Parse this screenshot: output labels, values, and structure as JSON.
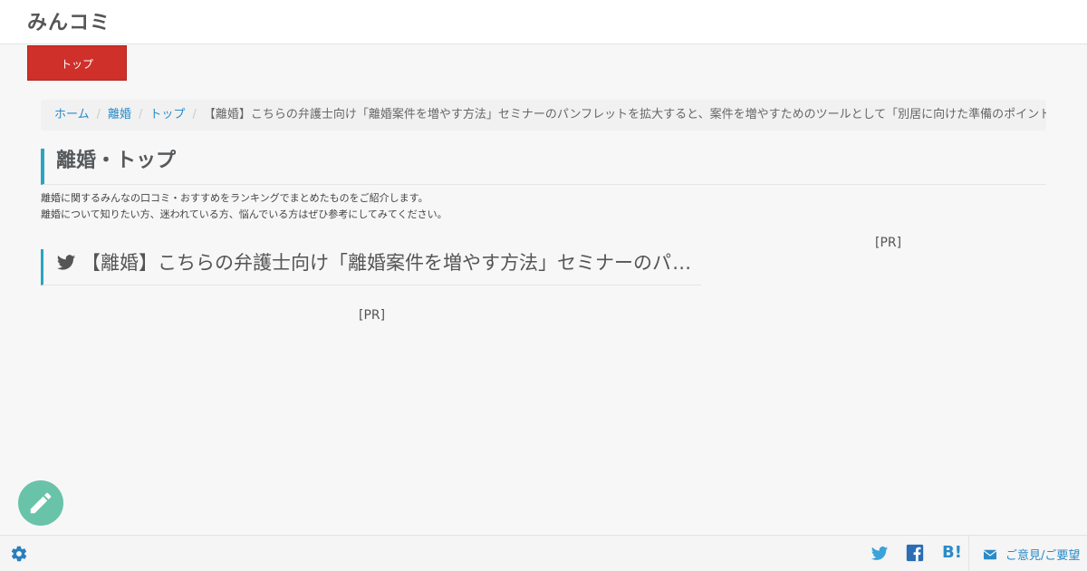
{
  "header": {
    "logo": "みんコミ"
  },
  "nav": {
    "active_tab": "トップ"
  },
  "breadcrumb": {
    "home": "ホーム",
    "category": "離婚",
    "section": "トップ",
    "current": "【離婚】こちらの弁護士向け「離婚案件を増やす方法」セミナーのパンフレットを拡大すると、案件を増やすためのツールとして「別居に向けた準備のポイント」"
  },
  "page": {
    "title": "離婚・トップ",
    "description_line1": "離婚に関するみんなの口コミ・おすすめをランキングでまとめたものをご紹介します。",
    "description_line2": "離婚について知りたい方、迷われている方、悩んでいる方はぜひ参考にしてみてください。"
  },
  "article": {
    "title": "【離婚】こちらの弁護士向け「離婚案件を増やす方法」セミナーのパンフレットを拡大すると…",
    "pr_label_center": "[PR]"
  },
  "sidebar": {
    "pr_label": "[PR]"
  },
  "footer": {
    "feedback_label": "ご意見/ご要望",
    "hatena_label": "B!"
  },
  "colors": {
    "accent": "#2aa5c0",
    "link": "#2a8bc9",
    "tab_red": "#d0302a",
    "fab_green": "#69c3a8"
  }
}
